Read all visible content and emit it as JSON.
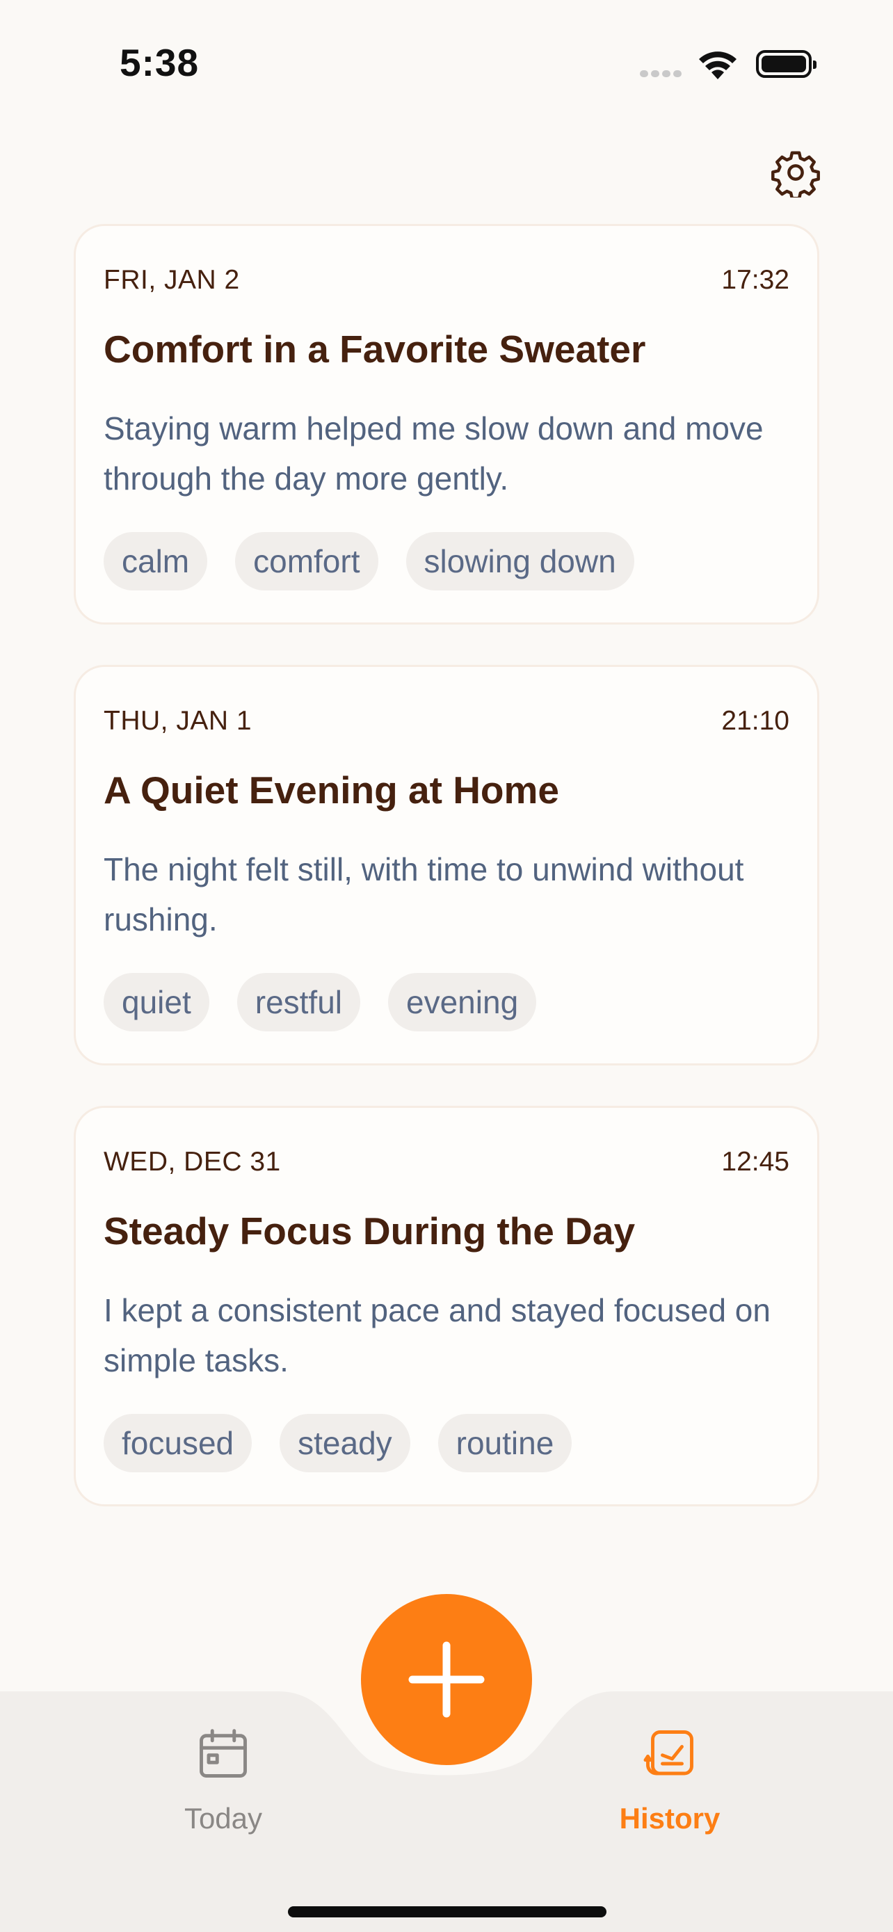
{
  "status_bar": {
    "time": "5:38"
  },
  "header": {
    "settings_icon": "gear-icon"
  },
  "entries": [
    {
      "date": "FRI, JAN 2",
      "time": "17:32",
      "title": "Comfort in a Favorite Sweater",
      "body": "Staying warm helped me slow down and move through the day more gently.",
      "tags": [
        "calm",
        "comfort",
        "slowing down"
      ]
    },
    {
      "date": "THU, JAN 1",
      "time": "21:10",
      "title": "A Quiet Evening at Home",
      "body": "The night felt still, with time to unwind without rushing.",
      "tags": [
        "quiet",
        "restful",
        "evening"
      ]
    },
    {
      "date": "WED, DEC 31",
      "time": "12:45",
      "title": "Steady Focus During the Day",
      "body": "I kept a consistent pace and stayed focused on simple tasks.",
      "tags": [
        "focused",
        "steady",
        "routine"
      ]
    }
  ],
  "tab_bar": {
    "tabs": [
      {
        "label": "Today",
        "icon": "calendar-icon",
        "active": false
      },
      {
        "label": "History",
        "icon": "journal-history-icon",
        "active": true
      }
    ],
    "add_button_icon": "plus-icon"
  },
  "colors": {
    "accent": "#fd7e14",
    "background": "#fbf9f6",
    "title_text": "#46210f",
    "body_text": "#52637f",
    "tag_background": "#f1eeeb",
    "tab_bar_background": "#f1eeeb"
  }
}
